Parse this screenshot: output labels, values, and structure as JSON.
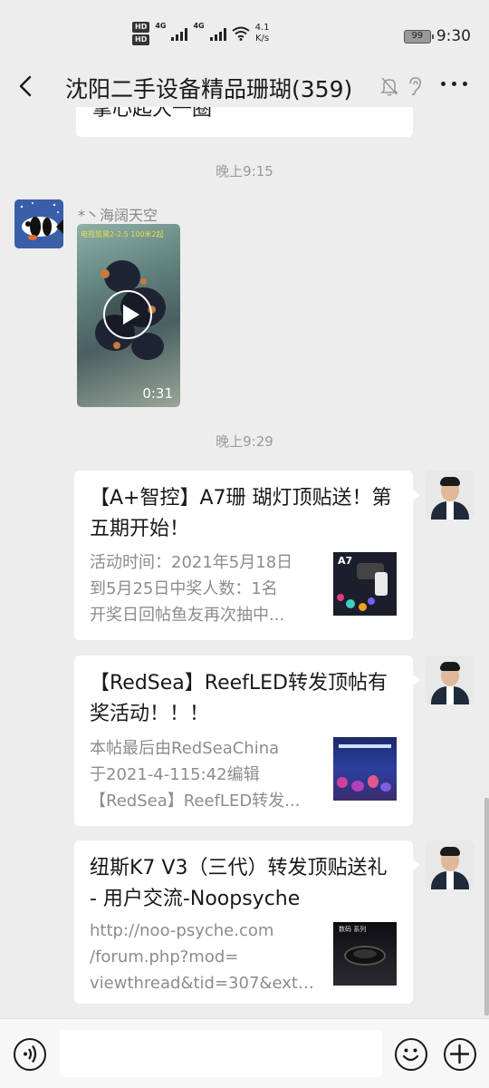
{
  "status_bar": {
    "hd1": "HD",
    "hd2": "HD",
    "net_gen1": "4G",
    "net_gen2": "4G",
    "speed_value": "4.1",
    "speed_unit": "K/s",
    "battery": "99",
    "time": "9:30"
  },
  "header": {
    "title": "沈阳二手设备精品珊瑚(359)"
  },
  "chat": {
    "previous_text": "掌心起大一圈",
    "time1": "晚上9:15",
    "sender_name": "*丶海阔天空",
    "video": {
      "caption": "电视监黑2-2.5 100米2起",
      "duration": "0:31"
    },
    "time2": "晚上9:29",
    "cards": [
      {
        "title": "【A+智控】A7珊 瑚灯顶贴送！第五期开始！",
        "desc": [
          "活动时间：2021年5月18日",
          "到5月25日中奖人数：1名",
          "开奖日回帖鱼友再次抽中..."
        ],
        "thumb_label": "A7"
      },
      {
        "title": "【RedSea】ReefLED转发顶帖有奖活动！！！",
        "desc": [
          "本帖最后由RedSeaChina",
          "于2021-4-115:42编辑",
          "【RedSea】ReefLED转发..."
        ]
      },
      {
        "title": "纽斯K7 V3（三代）转发顶贴送礼 - 用户交流-Noopsyche",
        "desc": [
          "http://noo-psyche.com",
          "/forum.php?mod=",
          "viewthread&tid=307&extr..."
        ],
        "thumb_label": "数码 系列"
      }
    ]
  },
  "colors": {
    "background": "#ededed",
    "bubble": "#ffffff",
    "muted_text": "#8c8c8c"
  },
  "icons": [
    "back-icon",
    "mute-bell-icon",
    "ear-icon",
    "more-icon",
    "voice-icon",
    "emoji-icon",
    "plus-icon",
    "play-icon"
  ]
}
